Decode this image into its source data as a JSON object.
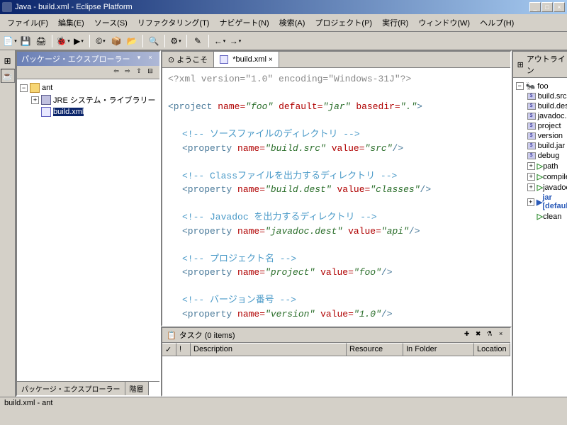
{
  "title": "Java - build.xml - Eclipse Platform",
  "menu": [
    "ファイル(F)",
    "編集(E)",
    "ソース(S)",
    "リファクタリング(T)",
    "ナビゲート(N)",
    "検索(A)",
    "プロジェクト(P)",
    "実行(R)",
    "ウィンドウ(W)",
    "ヘルプ(H)"
  ],
  "explorer": {
    "title": "パッケージ・エクスプローラー",
    "root": "ant",
    "lib": "JRE システム・ライブラリー",
    "file": "build.xml",
    "tab1": "パッケージ・エクスプローラー",
    "tab2": "階層"
  },
  "editor": {
    "tab1": "ようこそ",
    "tab2": "*build.xml",
    "xml_decl": "<?xml version=\"1.0\" encoding=\"Windows-31J\"?>",
    "project_open": "<project name=\"foo\" default=\"jar\" basedir=\".\">",
    "comment1": "<!-- ソースファイルのディレクトリ -->",
    "prop1": "<property name=\"build.src\" value=\"src\"/>",
    "comment2": "<!-- Classファイルを出力するディレクトリ -->",
    "prop2": "<property name=\"build.dest\" value=\"classes\"/>",
    "comment3": "<!-- Javadoc を出力するディレクトリ -->",
    "prop3": "<property name=\"javadoc.dest\" value=\"api\"/>",
    "comment4": "<!-- プロジェクト名 -->",
    "prop4": "<property name=\"project\" value=\"foo\"/>",
    "comment5": "<!-- バージョン番号 -->",
    "prop5": "<property name=\"version\" value=\"1.0\"/>"
  },
  "outline": {
    "title": "アウトライン",
    "root": "foo",
    "props": [
      "build.src",
      "build.dest",
      "javadoc.dest",
      "project",
      "version",
      "build.jar",
      "debug"
    ],
    "targets": [
      "path",
      "compile",
      "javadoc"
    ],
    "default_target": "jar [default]",
    "last_target": "clean"
  },
  "tasks": {
    "title": "タスク (0 items)",
    "cols": {
      "c1": "✓",
      "c2": "!",
      "desc": "Description",
      "res": "Resource",
      "folder": "In Folder",
      "loc": "Location"
    }
  },
  "status": "build.xml - ant"
}
